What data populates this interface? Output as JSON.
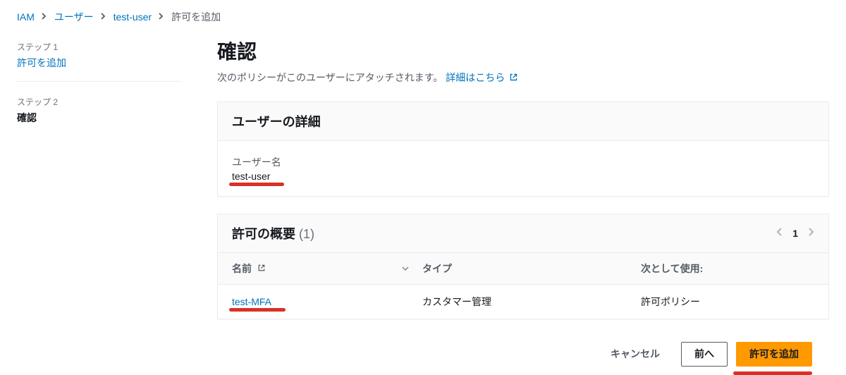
{
  "breadcrumb": {
    "items": [
      {
        "label": "IAM"
      },
      {
        "label": "ユーザー"
      },
      {
        "label": "test-user"
      }
    ],
    "current": "許可を追加"
  },
  "sidebar": {
    "steps": [
      {
        "label": "ステップ 1",
        "title": "許可を追加"
      },
      {
        "label": "ステップ 2",
        "title": "確認"
      }
    ]
  },
  "page": {
    "title": "確認",
    "subtitle_text": "次のポリシーがこのユーザーにアタッチされます。",
    "subtitle_link": "詳細はこちら"
  },
  "user_details": {
    "heading": "ユーザーの詳細",
    "username_label": "ユーザー名",
    "username_value": "test-user"
  },
  "permissions_summary": {
    "heading": "許可の概要",
    "count_display": "(1)",
    "pager_page": "1",
    "columns": {
      "name": "名前",
      "type": "タイプ",
      "used_as": "次として使用:"
    },
    "rows": [
      {
        "name": "test-MFA",
        "type": "カスタマー管理",
        "used_as": "許可ポリシー"
      }
    ]
  },
  "actions": {
    "cancel": "キャンセル",
    "prev": "前へ",
    "submit": "許可を追加"
  }
}
